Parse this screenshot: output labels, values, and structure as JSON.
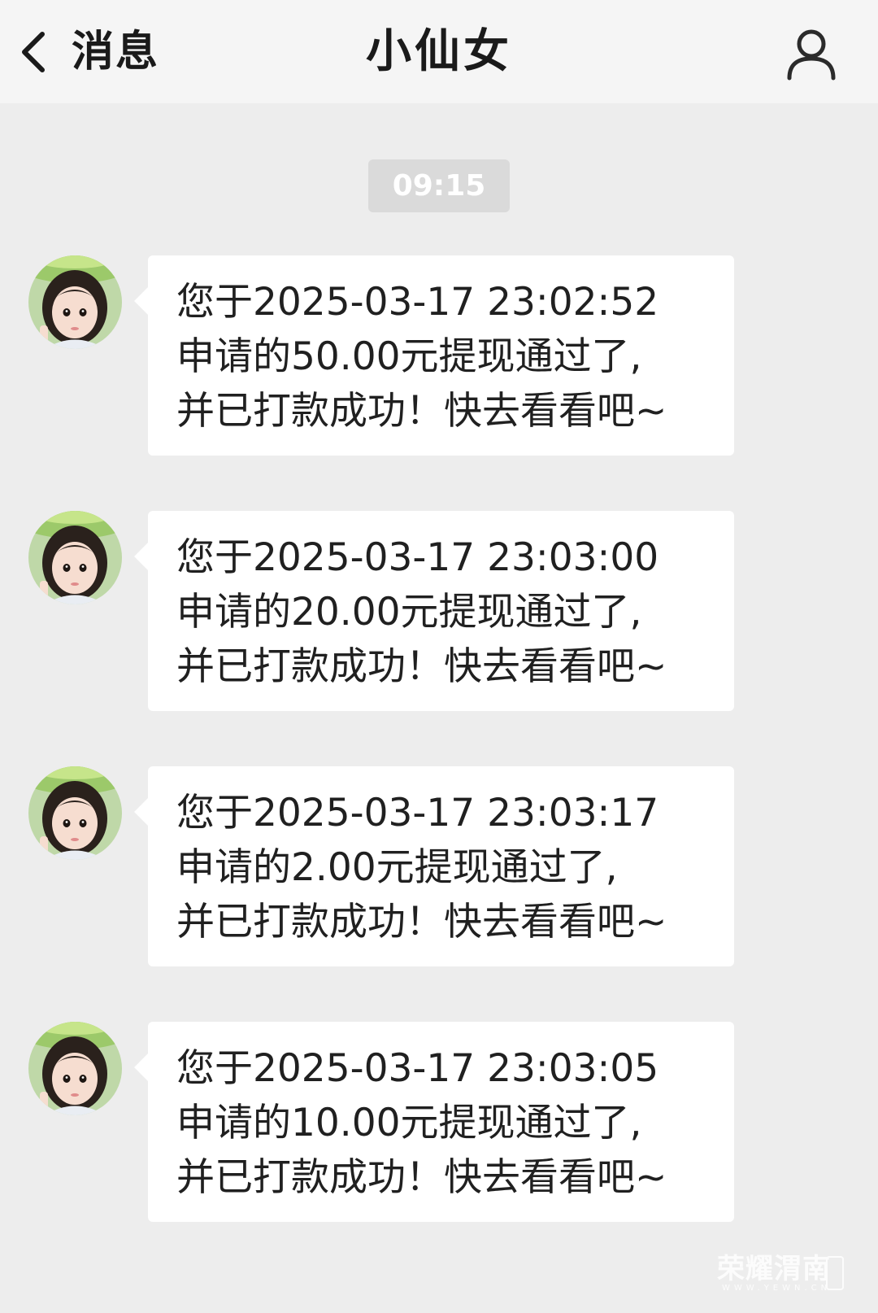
{
  "header": {
    "back_label": "消息",
    "title": "小仙女"
  },
  "timestamp": "09:15",
  "messages": [
    {
      "text": "您于2025-03-17 23:02:52\n申请的50.00元提现通过了,\n并已打款成功！快去看看吧~"
    },
    {
      "text": "您于2025-03-17 23:03:00\n申请的20.00元提现通过了,\n并已打款成功！快去看看吧~"
    },
    {
      "text": "您于2025-03-17 23:03:17\n申请的2.00元提现通过了,\n并已打款成功！快去看看吧~"
    },
    {
      "text": "您于2025-03-17 23:03:05\n申请的10.00元提现通过了,\n并已打款成功！快去看看吧~"
    }
  ],
  "watermark": {
    "text": "荣耀渭南",
    "sub": "WWW.YEWN.CN"
  },
  "icons": {
    "back": "chevron-left-icon",
    "profile": "user-icon"
  },
  "colors": {
    "background": "#ededed",
    "header": "#f5f5f5",
    "bubble": "#ffffff",
    "timestamp_bg": "#dadada"
  }
}
